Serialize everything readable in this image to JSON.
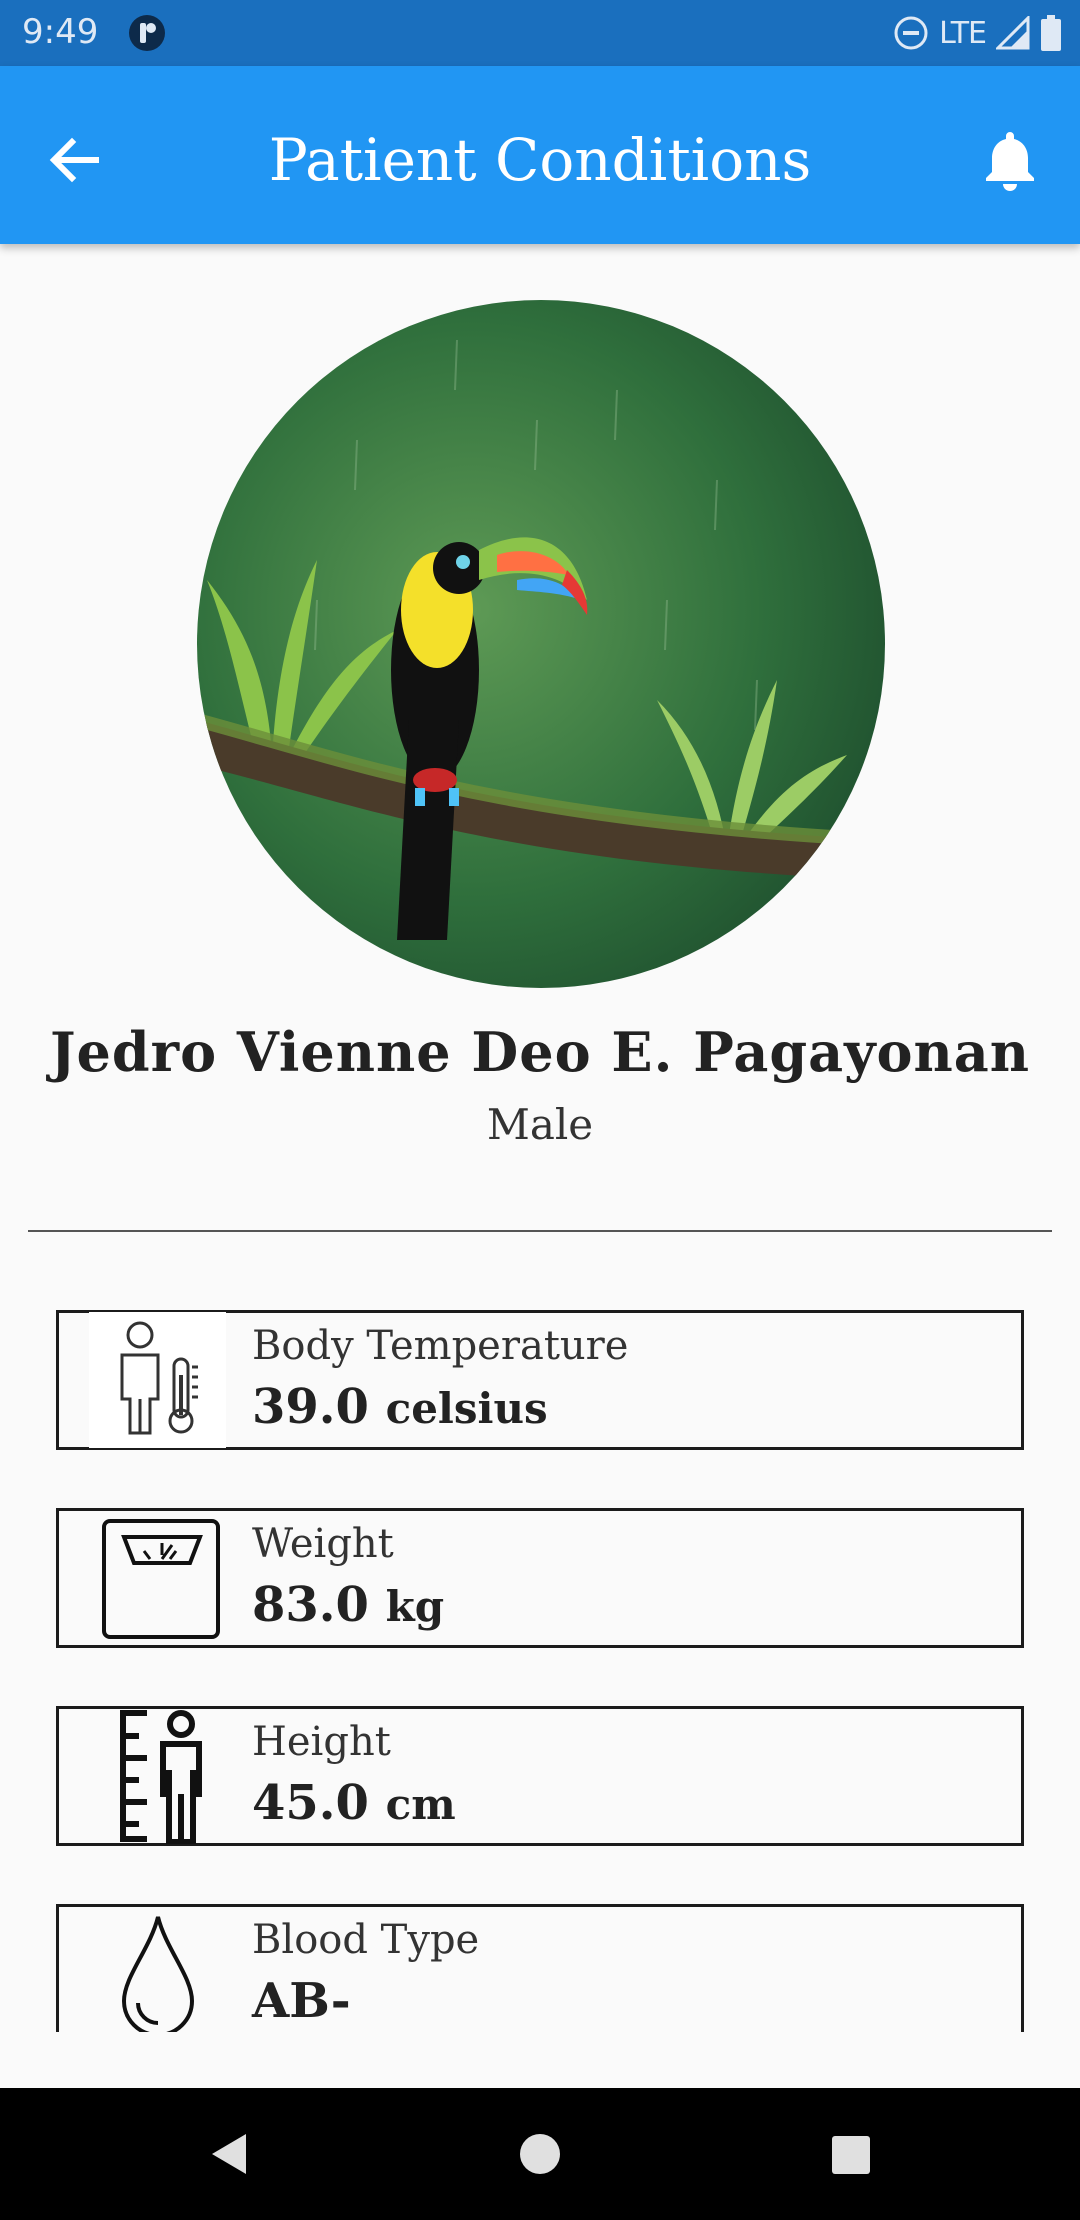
{
  "status_bar": {
    "time": "9:49",
    "network": "LTE",
    "icons": [
      "app-notification-icon",
      "do-not-disturb-icon",
      "signal-icon",
      "battery-icon"
    ]
  },
  "app_bar": {
    "title": "Patient Conditions",
    "back_icon": "arrow-back-icon",
    "bell_icon": "bell-icon",
    "color": "#2196f3"
  },
  "patient": {
    "name": "Jedro Vienne Deo E. Pagayonan",
    "gender": "Male",
    "avatar": "toucan-on-branch-photo"
  },
  "conditions": [
    {
      "label": "Body Temperature",
      "value": "39.0",
      "unit": "celsius",
      "icon": "thermometer-person-icon"
    },
    {
      "label": "Weight",
      "value": "83.0",
      "unit": "kg",
      "icon": "scale-icon"
    },
    {
      "label": "Height",
      "value": "45.0",
      "unit": "cm",
      "icon": "height-ruler-icon"
    },
    {
      "label": "Blood Type",
      "value": "AB-",
      "unit": "",
      "icon": "blood-drop-icon"
    }
  ],
  "nav_bar": {
    "icons": [
      "back-triangle-icon",
      "home-circle-icon",
      "recents-square-icon"
    ]
  }
}
